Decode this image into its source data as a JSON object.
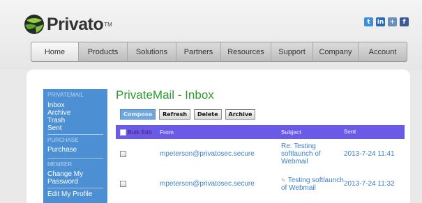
{
  "brand": {
    "name": "Privato",
    "tm": "TM"
  },
  "social": [
    {
      "icon": "twitter-icon",
      "glyph": "t",
      "color": "#3d8fd6"
    },
    {
      "icon": "linkedin-icon",
      "glyph": "in",
      "color": "#2d6cb5"
    },
    {
      "icon": "add-icon",
      "glyph": "+",
      "color": "#6a8fb8"
    },
    {
      "icon": "facebook-icon",
      "glyph": "f",
      "color": "#3b5a9a"
    }
  ],
  "nav": [
    {
      "label": "Home",
      "active": true
    },
    {
      "label": "Products"
    },
    {
      "label": "Solutions"
    },
    {
      "label": "Partners"
    },
    {
      "label": "Resources"
    },
    {
      "label": "Support"
    },
    {
      "label": "Company"
    },
    {
      "label": "Account"
    }
  ],
  "sidebar": {
    "privatemail_head": "PRIVATEMAIL",
    "inbox": "Inbox",
    "archive": "Archive",
    "trash": "Trash",
    "sent": "Sent",
    "purchase_head": "PURCHASE",
    "purchase": "Purchase",
    "member_head": "MEMBER",
    "change_password": "Change My Password",
    "edit_profile": "Edit My Profile"
  },
  "page_title": "PrivateMail - Inbox",
  "toolbar": {
    "compose": "Compose",
    "refresh": "Refresh",
    "delete": "Delete",
    "archive": "Archive"
  },
  "table": {
    "headers": {
      "bulk": "Bulk Edit",
      "from": "From",
      "subject": "Subject",
      "sent": "Sent"
    },
    "rows": [
      {
        "from": "mpeterson@privatosec.secure",
        "subject": "Re: Testing softlaunch of Webmail",
        "sent": "2013-7-24 11:41",
        "draft": false
      },
      {
        "from": "mpeterson@privatosec.secure",
        "subject": "Testing softlaunch of Webmail",
        "sent": "2013-7-24 11:32",
        "draft": true
      }
    ]
  },
  "colors": {
    "accent_green": "#2e9a2e",
    "sidebar_blue": "#4d8fd3",
    "table_header": "#6a5ae8",
    "link_blue": "#3b7fc9"
  }
}
